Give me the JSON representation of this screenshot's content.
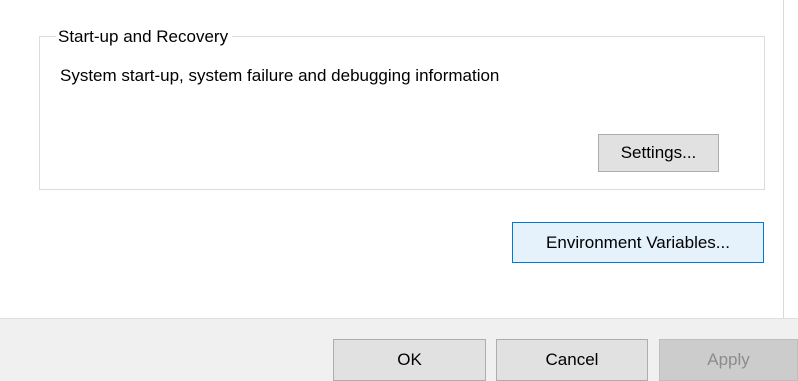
{
  "startup_recovery": {
    "legend": "Start-up and Recovery",
    "description": "System start-up, system failure and debugging information",
    "settings_label": "Settings..."
  },
  "environment_variables_label": "Environment Variables...",
  "footer": {
    "ok_label": "OK",
    "cancel_label": "Cancel",
    "apply_label": "Apply"
  },
  "colors": {
    "button_face": "#e1e1e1",
    "button_border": "#adadad",
    "focused_button_face": "#e5f1fb",
    "focused_button_border": "#0078d7",
    "disabled_button_face": "#cccccc",
    "disabled_text": "#8c8c8c",
    "footer_background": "#f0f0f0"
  }
}
